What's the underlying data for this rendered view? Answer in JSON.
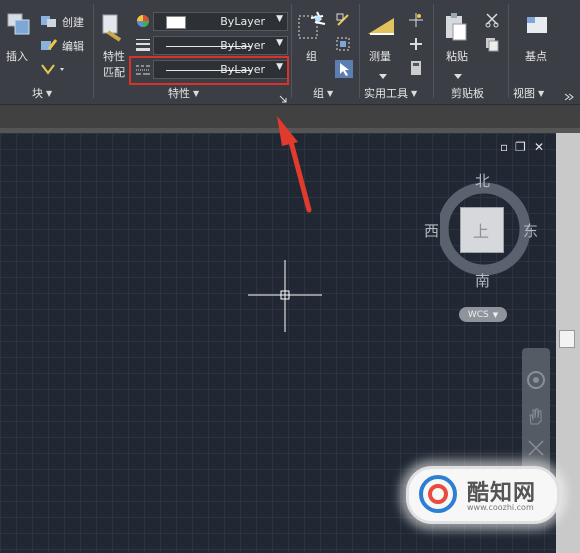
{
  "ribbon": {
    "block_panel": {
      "insert_label": "插入",
      "create_label": "创建",
      "edit_label": "编辑",
      "panel_label": "块"
    },
    "properties_panel": {
      "match_label_line1": "特性",
      "match_label_line2": "匹配",
      "color_combo": "ByLayer",
      "lineweight_combo": "ByLayer",
      "linetype_combo": "ByLayer",
      "panel_label": "特性"
    },
    "group_panel": {
      "group_label": "组",
      "panel_label": "组"
    },
    "utilities_panel": {
      "measure_label": "测量",
      "panel_label": "实用工具"
    },
    "clipboard_panel": {
      "paste_label": "粘贴",
      "panel_label": "剪贴板"
    },
    "view_panel": {
      "basepoint_label": "基点",
      "panel_label": "视图"
    }
  },
  "viewport_controls": {
    "minimize": "▫",
    "restore": "❐",
    "close": "✕"
  },
  "viewcube": {
    "north": "北",
    "south": "南",
    "east": "东",
    "west": "西",
    "face": "上",
    "wcs_label": "WCS"
  },
  "watermark": {
    "text": "酷知网",
    "url": "www.coozhi.com",
    "logo": "C"
  },
  "colors": {
    "highlight_box": "#d9322a",
    "arrow": "#e23b2e"
  }
}
